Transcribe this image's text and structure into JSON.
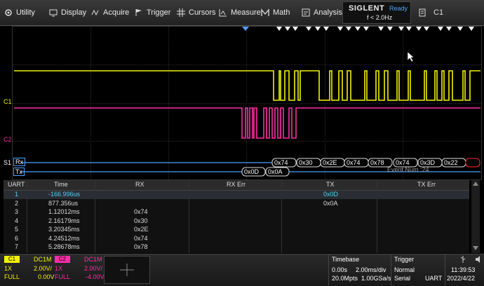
{
  "menu": [
    {
      "label": "Utility",
      "icon": "utility-icon"
    },
    {
      "label": "Display",
      "icon": "display-icon"
    },
    {
      "label": "Acquire",
      "icon": "acquire-icon"
    },
    {
      "label": "Trigger",
      "icon": "trigger-flag-icon"
    },
    {
      "label": "Cursors",
      "icon": "cursors-icon"
    },
    {
      "label": "Measure",
      "icon": "measure-icon"
    },
    {
      "label": "Math",
      "icon": "math-icon"
    },
    {
      "label": "Analysis",
      "icon": "analysis-icon"
    }
  ],
  "brand": {
    "logo": "SIGLENT",
    "status": "Ready",
    "freq": "f < 2.0Hz"
  },
  "channel_indicator": "C1",
  "traces": {
    "c1_label": "C1",
    "c2_label": "C2",
    "s1_label": "S1",
    "rx_label": "Rx",
    "tx_label": "Tx",
    "c1_color": "#f2f200",
    "c2_color": "#ff2ea6",
    "serial_color": "#4aa3ff"
  },
  "decode_rx": [
    "0x74",
    "0x30",
    "0x2E",
    "0x74",
    "0x78",
    "0x74",
    "0x3D",
    "0x22"
  ],
  "decode_tx": [
    "0x0D",
    "0x0A"
  ],
  "event_num": "Event Num :24",
  "table": {
    "headers": [
      "UART",
      "Time",
      "RX",
      "RX Err",
      "TX",
      "TX Err"
    ],
    "rows": [
      {
        "uart": "1",
        "time": "-166.996us",
        "rx": "",
        "rxerr": "",
        "tx": "0x0D",
        "txerr": ""
      },
      {
        "uart": "2",
        "time": "877.356us",
        "rx": "",
        "rxerr": "",
        "tx": "0x0A",
        "txerr": ""
      },
      {
        "uart": "3",
        "time": "1.12012ms",
        "rx": "0x74",
        "rxerr": "",
        "tx": "",
        "txerr": ""
      },
      {
        "uart": "4",
        "time": "2.16179ms",
        "rx": "0x30",
        "rxerr": "",
        "tx": "",
        "txerr": ""
      },
      {
        "uart": "5",
        "time": "3.20345ms",
        "rx": "0x2E",
        "rxerr": "",
        "tx": "",
        "txerr": ""
      },
      {
        "uart": "6",
        "time": "4.24512ms",
        "rx": "0x74",
        "rxerr": "",
        "tx": "",
        "txerr": ""
      },
      {
        "uart": "7",
        "time": "5.28678ms",
        "rx": "0x78",
        "rxerr": "",
        "tx": "",
        "txerr": ""
      }
    ]
  },
  "ch1": {
    "tag": "C1",
    "coupling": "DC1M",
    "probe": "1X",
    "scale": "2.00V/",
    "bw": "FULL",
    "offset": "0.00V",
    "color": "#f2f200"
  },
  "ch2": {
    "tag": "C2",
    "coupling": "DC1M",
    "probe": "1X",
    "scale": "2.00V/",
    "bw": "FULL",
    "offset": "-4.00V",
    "color": "#ff2ea6"
  },
  "timebase": {
    "title": "Timebase",
    "delay": "0.00s",
    "scale": "2.00ms/div",
    "mpts": "20.0Mpts",
    "rate": "1.00GSa/s"
  },
  "trigger": {
    "title": "Trigger",
    "mode": "Normal",
    "type": "Serial",
    "source": "UART"
  },
  "clock": {
    "time": "11:39:53",
    "date": "2022/4/22"
  }
}
